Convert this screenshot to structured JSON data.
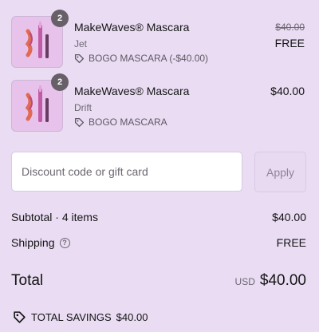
{
  "items": [
    {
      "quantity": "2",
      "name": "MakeWaves® Mascara",
      "variant": "Jet",
      "discount_label": "BOGO MASCARA (-$40.00)",
      "price_original": "$40.00",
      "price_final": "FREE",
      "tag_icon": "tag-icon"
    },
    {
      "quantity": "2",
      "name": "MakeWaves® Mascara",
      "variant": "Drift",
      "discount_label": "BOGO MASCARA",
      "price": "$40.00",
      "tag_icon": "tag-icon"
    }
  ],
  "discount": {
    "placeholder": "Discount code or gift card",
    "apply_label": "Apply"
  },
  "summary": {
    "subtotal_label": "Subtotal · 4 items",
    "subtotal_value": "$40.00",
    "shipping_label": "Shipping",
    "shipping_value": "FREE",
    "total_label": "Total",
    "currency": "USD",
    "total_value": "$40.00",
    "savings_label": "TOTAL SAVINGS",
    "savings_value": "$40.00"
  },
  "colors": {
    "background": "#e9dcf3",
    "thumbnail": "#e7c3eb",
    "badge": "#676068",
    "muted_text": "#6d6872"
  }
}
